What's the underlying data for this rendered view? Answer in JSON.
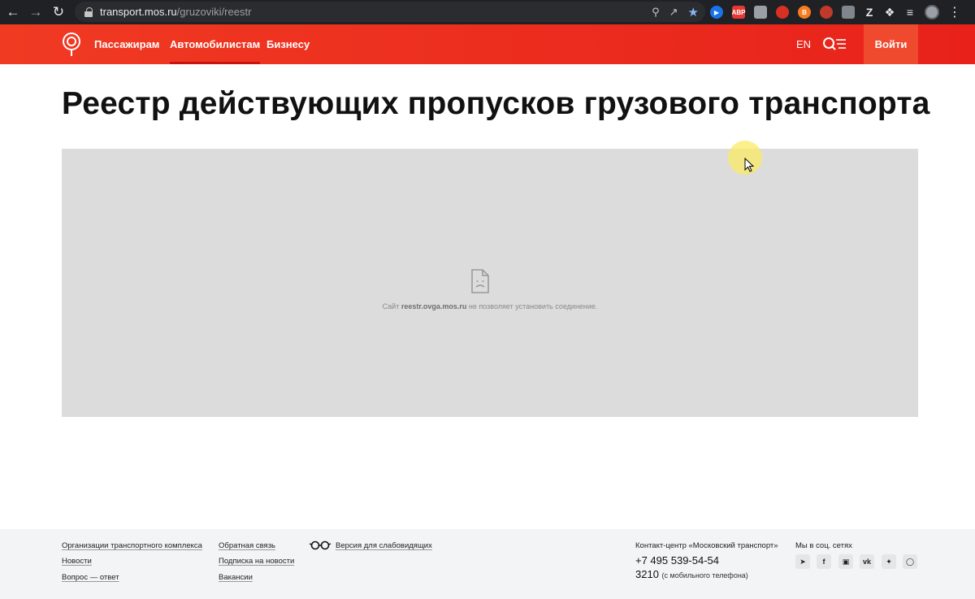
{
  "browser": {
    "url_host": "transport.mos.ru",
    "url_path": "/gruzoviki/reestr",
    "extensions": [
      {
        "name": "adblock",
        "label": "ABP",
        "color": "#e53935"
      },
      {
        "name": "z",
        "label": "Z"
      }
    ]
  },
  "header": {
    "nav": [
      "Пассажирам",
      "Автомобилистам",
      "Бизнесу"
    ],
    "active_nav": "Автомобилистам",
    "lang": "EN",
    "login_label": "Войти",
    "accent_color": "#e8221b"
  },
  "main": {
    "title": "Реестр действующих пропусков грузового транспорта",
    "frame_message_prefix": "Сайт",
    "frame_message_host": "reestr.ovga.mos.ru",
    "frame_message_suffix": "не позволяет установить соединение."
  },
  "footer": {
    "col1": [
      "Организации транспортного комплекса",
      "Новости",
      "Вопрос — ответ"
    ],
    "col2": [
      "Обратная связь",
      "Подписка на новости",
      "Вакансии"
    ],
    "accessibility": "Версия для слабовидящих",
    "contact_label": "Контакт-центр «Московский транспорт»",
    "phone": "+7 495 539-54-54",
    "short_number": "3210",
    "short_number_note": "(с мобильного телефона)",
    "social_label": "Мы в соц. сетях",
    "social_icons": [
      "telegram-icon",
      "facebook-icon",
      "instagram-icon",
      "vk-icon",
      "twitter-icon",
      "odnoklassniki-icon"
    ]
  }
}
